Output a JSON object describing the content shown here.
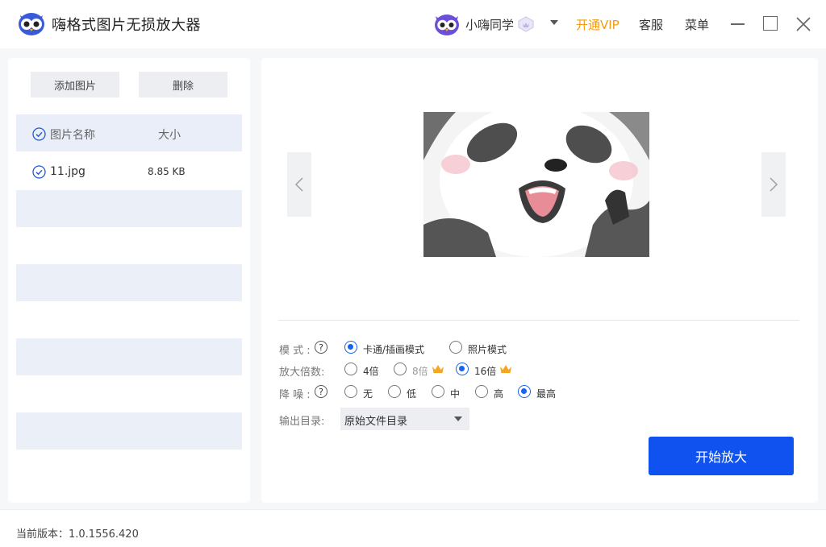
{
  "app": {
    "title": "嗨格式图片无损放大器",
    "logo_icon": "owl-logo-icon"
  },
  "header": {
    "user_name": "小嗨同学",
    "open_vip": "开通VIP",
    "service": "客服",
    "menu": "菜单",
    "vip_color": "#f59a12"
  },
  "file_panel": {
    "add_button": "添加图片",
    "delete_button": "删除",
    "columns": {
      "name": "图片名称",
      "size": "大小"
    },
    "files": [
      {
        "name": "11.jpg",
        "size": "8.85 KB"
      }
    ]
  },
  "settings": {
    "mode": {
      "label": "模 式 :",
      "options": [
        "卡通/插画模式",
        "照片模式"
      ],
      "selected": "卡通/插画模式"
    },
    "scale": {
      "label": "放大倍数:",
      "options": [
        "4倍",
        "8倍",
        "16倍"
      ],
      "selected": "16倍"
    },
    "denoise": {
      "label": "降 噪 :",
      "options": [
        "无",
        "低",
        "中",
        "高",
        "最高"
      ],
      "selected": "最高"
    },
    "output": {
      "label": "输出目录:",
      "value": "原始文件目录"
    },
    "help_symbol": "?"
  },
  "start_button": "开始放大",
  "accent_color": "#1052f0",
  "footer": {
    "version": "当前版本：1.0.1556.420"
  }
}
